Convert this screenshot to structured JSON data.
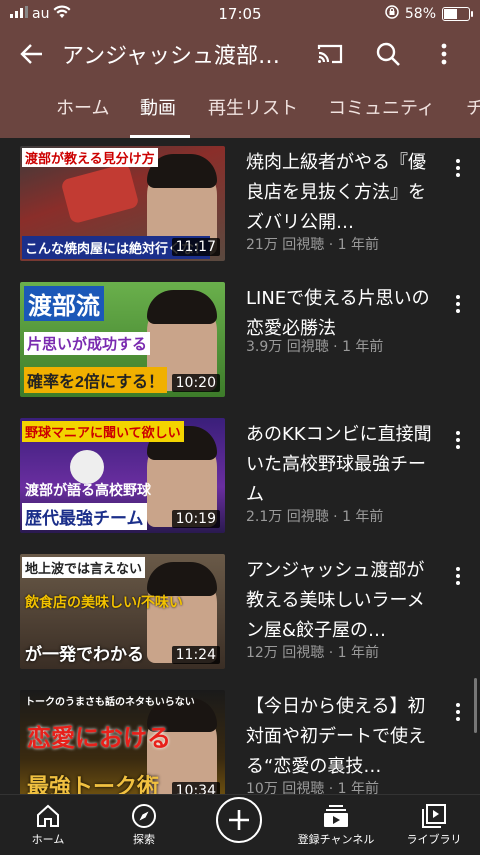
{
  "status_bar": {
    "carrier": "au",
    "time": "17:05",
    "battery": "58%",
    "battery_level": 0.58
  },
  "app_bar": {
    "title": "アンジャッシュ渡部…"
  },
  "tabs": [
    {
      "label": "ホーム"
    },
    {
      "label": "動画"
    },
    {
      "label": "再生リスト"
    },
    {
      "label": "コミュニティ"
    },
    {
      "label": "チ"
    }
  ],
  "videos": [
    {
      "title": "焼肉上級者がやる『優良店を見抜く方法』をズバリ公開…",
      "meta": "21万 回視聴 · 1 年前",
      "duration": "11:17",
      "thumb_caption_top": "渡部が教える見分け方",
      "thumb_caption_bottom": "こんな焼肉屋には絶対行くな！"
    },
    {
      "title": "LINEで使える片思いの恋愛必勝法",
      "meta": "3.9万 回視聴 · 1 年前",
      "duration": "10:20",
      "thumb_caption_top": "渡部流",
      "thumb_caption_mid": "片思いが成功する",
      "thumb_caption_bottom": "確率を2倍にする！"
    },
    {
      "title": "あのKKコンビに直接聞いた高校野球最強チーム",
      "meta": "2.1万 回視聴 · 1 年前",
      "duration": "10:19",
      "thumb_caption_top": "野球マニアに聞いて欲しい",
      "thumb_caption_mid": "渡部が語る高校野球",
      "thumb_caption_bottom": "歴代最強チーム"
    },
    {
      "title": "アンジャッシュ渡部が教える美味しいラーメン屋&餃子屋の…",
      "meta": "12万 回視聴 · 1 年前",
      "duration": "11:24",
      "thumb_caption_top": "地上波では言えない",
      "thumb_caption_mid": "飲食店の美味しい/不味い",
      "thumb_caption_bottom": "が一発でわかる"
    },
    {
      "title": "【今日から使える】初対面や初デートで使える“恋愛の裏技…",
      "meta": "10万 回視聴 · 1 年前",
      "duration": "10:34",
      "thumb_caption_top": "トークのうまさも話のネタもいらない",
      "thumb_caption_mid": "恋愛における",
      "thumb_caption_bottom": "最強トーク術"
    }
  ],
  "bottom_nav": [
    {
      "label": "ホーム"
    },
    {
      "label": "探索"
    },
    {
      "label": ""
    },
    {
      "label": "登録チャンネル"
    },
    {
      "label": "ライブラリ"
    }
  ],
  "colors": {
    "header": "#6b4540",
    "background": "#212121",
    "meta_text": "#9a9a9a"
  }
}
